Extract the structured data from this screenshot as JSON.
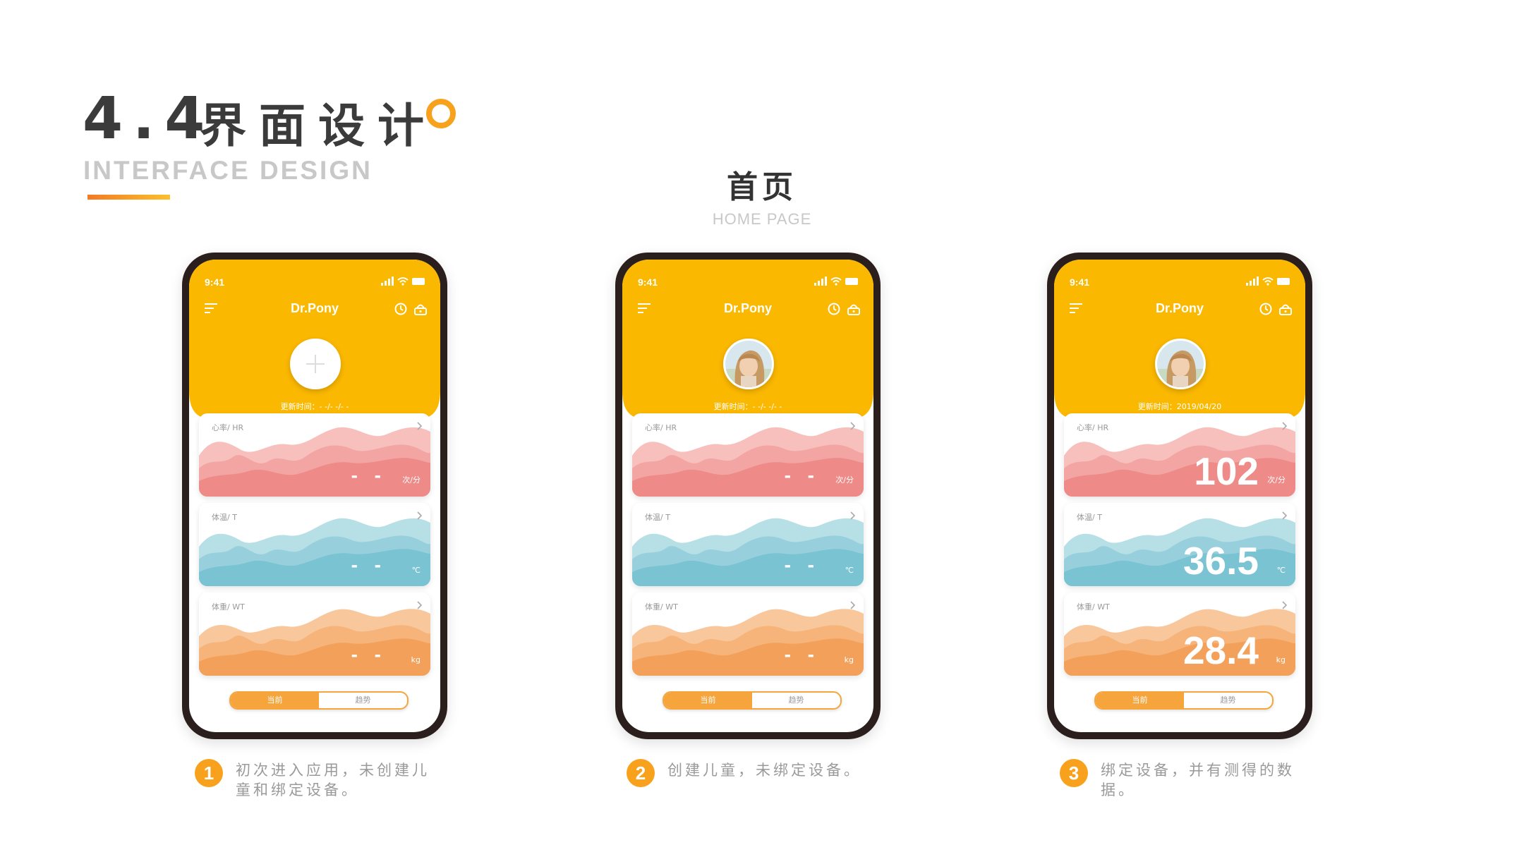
{
  "page": {
    "title_number": "4.4",
    "title_cn": "界面设计",
    "title_en": "INTERFACE DESIGN",
    "section_cn": "首页",
    "section_en": "HOME PAGE"
  },
  "colors": {
    "accent_yellow": "#fbb800",
    "heart_rate": "#ef8e8a",
    "temperature": "#79c3d2",
    "weight": "#f4a25d",
    "title_dot": "#f7a11d"
  },
  "phones": [
    {
      "status_time": "9:41",
      "app_title": "Dr.Pony",
      "avatar": "plus-icon",
      "update_label": "更新时间：",
      "update_value": "- -/- -/- -",
      "cards": [
        {
          "label": "心率/ HR",
          "value": "- -",
          "unit": "次/分"
        },
        {
          "label": "体温/ T",
          "value": "- -",
          "unit": "℃"
        },
        {
          "label": "体重/ WT",
          "value": "- -",
          "unit": "kg"
        }
      ],
      "toggle": {
        "current": "当前",
        "trend": "趋势"
      },
      "caption_num": "1",
      "caption": "初次进入应用，未创建儿童和绑定设备。"
    },
    {
      "status_time": "9:41",
      "app_title": "Dr.Pony",
      "avatar": "child-photo",
      "update_label": "更新时间：",
      "update_value": "- -/- -/- -",
      "cards": [
        {
          "label": "心率/ HR",
          "value": "- -",
          "unit": "次/分"
        },
        {
          "label": "体温/ T",
          "value": "- -",
          "unit": "℃"
        },
        {
          "label": "体重/ WT",
          "value": "- -",
          "unit": "kg"
        }
      ],
      "toggle": {
        "current": "当前",
        "trend": "趋势"
      },
      "caption_num": "2",
      "caption": "创建儿童，未绑定设备。"
    },
    {
      "status_time": "9:41",
      "app_title": "Dr.Pony",
      "avatar": "child-photo",
      "update_label": "更新时间：",
      "update_value": "2019/04/20",
      "cards": [
        {
          "label": "心率/ HR",
          "value": "102",
          "unit": "次/分"
        },
        {
          "label": "体温/ T",
          "value": "36.5",
          "unit": "℃"
        },
        {
          "label": "体重/ WT",
          "value": "28.4",
          "unit": "kg"
        }
      ],
      "toggle": {
        "current": "当前",
        "trend": "趋势"
      },
      "caption_num": "3",
      "caption": "绑定设备，并有测得的数据。"
    }
  ]
}
